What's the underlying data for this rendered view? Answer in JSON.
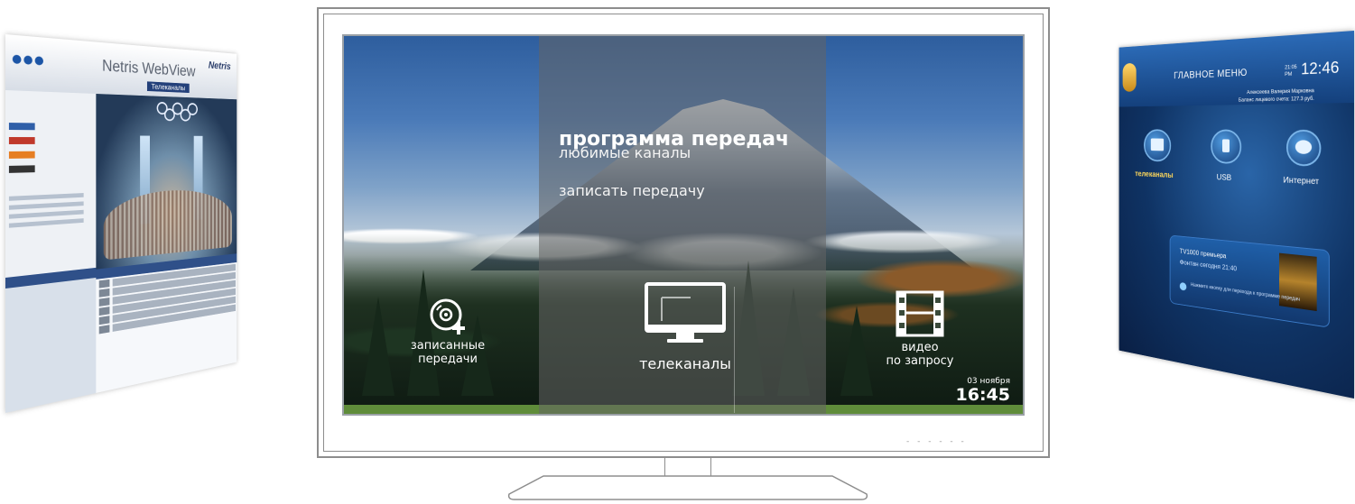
{
  "left_screen": {
    "title": "Netris WebView",
    "brand": "Netris",
    "subtitle": "Телеканалы"
  },
  "right_screen": {
    "title": "ГЛАВНОЕ МЕНЮ",
    "time": "12:46",
    "ampm_top": "21:05",
    "ampm_bottom": "PM",
    "user_line1": "Алексеева Валерия Марковна",
    "user_line2": "Баланс лицевого счета: 127.3 руб.",
    "tiles": [
      {
        "label": "телеканалы",
        "icon": "tv-icon"
      },
      {
        "label": "USB",
        "icon": "usb-icon"
      },
      {
        "label": "Интернет",
        "icon": "globe-icon"
      }
    ],
    "card": {
      "line1": "TV1000 премьера",
      "line2": "Фонтан   сегодня 21:40",
      "hint": "Нажмите кнопку для перехода к программе передач"
    }
  },
  "tv": {
    "menu": {
      "active": "программа передач",
      "items": [
        "любимые каналы",
        "записать передачу"
      ]
    },
    "tiles": {
      "recorded": {
        "line1": "записанные",
        "line2": "передачи"
      },
      "channels": {
        "label": "телеканалы"
      },
      "vod": {
        "line1": "видео",
        "line2": "по запросу"
      }
    },
    "clock": {
      "date": "03 ноября",
      "time": "16:45"
    },
    "led_indicators": "- - - - - -"
  },
  "colors": {
    "overlay": "#646464",
    "frame": "#8d8d8d",
    "accent_right": "#ffd85a"
  }
}
